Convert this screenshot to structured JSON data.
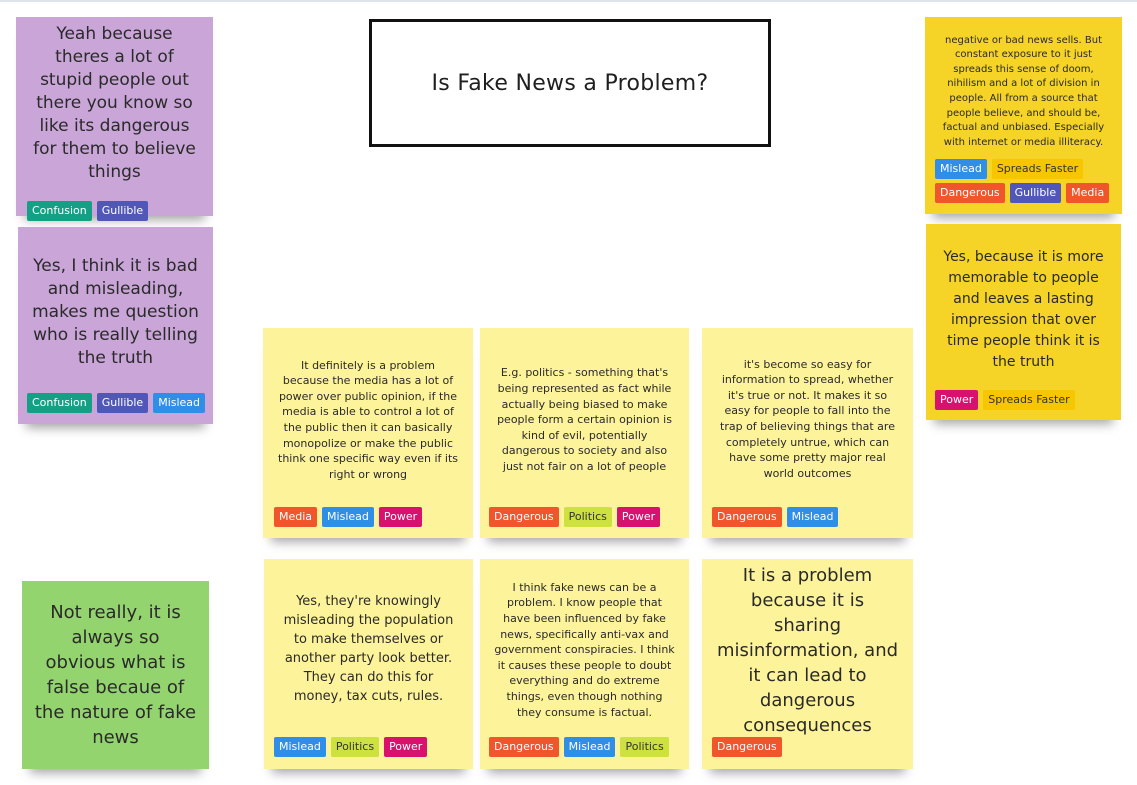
{
  "board": {
    "title": "Is Fake News a Problem?"
  },
  "notes": [
    {
      "text": "Yeah because theres a lot of stupid people out there you know so like its dangerous for them to believe things",
      "tags": [
        "Confusion",
        "Gullible"
      ]
    },
    {
      "text": "Yes, I think it is bad and misleading, makes me question who is really telling the truth",
      "tags": [
        "Confusion",
        "Gullible",
        "Mislead"
      ]
    },
    {
      "text": "Not really, it is always so obvious what is false becaue of the nature of fake news",
      "tags": []
    },
    {
      "text": "It definitely is a problem because the media has a lot of power over public opinion, if the media is able to control a lot of the public then it can basically monopolize or make the public think one specific way even if its right or wrong",
      "tags": [
        "Media",
        "Mislead",
        "Power"
      ]
    },
    {
      "text": "E.g. politics - something that's being represented as fact while actually being biased to make people form a certain opinion is kind of evil, potentially dangerous to society and also just not fair on a lot of people",
      "tags": [
        "Dangerous",
        "Politics",
        "Power"
      ]
    },
    {
      "text": "it's become so easy for information to spread, whether it's true or not. It makes it so easy for people to fall into the trap of believing things that are completely untrue, which can have some pretty major real world outcomes",
      "tags": [
        "Dangerous",
        "Mislead"
      ]
    },
    {
      "text": "Yes, they're knowingly misleading the population to make themselves or another party look better. They can do this for money, tax cuts, rules.",
      "tags": [
        "Mislead",
        "Politics",
        "Power"
      ]
    },
    {
      "text": "I think fake news can be a problem. I know people that have been influenced by fake news, specifically anti-vax and government conspiracies. I think it causes these people to doubt everything and do extreme things, even though nothing they consume is factual.",
      "tags": [
        "Dangerous",
        "Mislead",
        "Politics"
      ]
    },
    {
      "text": "It is a problem because it is sharing misinformation, and it can lead to dangerous consequences",
      "tags": [
        "Dangerous"
      ]
    },
    {
      "text": "negative or bad news sells. But constant exposure to it just spreads this sense of doom, nihilism and a lot of division in people. All from a source that people believe, and should be, factual and unbiased. Especially with internet or media illiteracy.",
      "tags": [
        "Mislead",
        "Spreads Faster",
        "Dangerous",
        "Gullible",
        "Media"
      ]
    },
    {
      "text": "Yes, because it is more memorable to people and leaves a lasting impression that over time people think it is the truth",
      "tags": [
        "Power",
        "Spreads Faster"
      ]
    }
  ],
  "colors": {
    "purple_note": "#c9a5d8",
    "green_note": "#93d46f",
    "yellow_note": "#fdf39a",
    "gold_note": "#f5d327",
    "tag_confusion": "#14a085",
    "tag_gullible": "#5057b8",
    "tag_mislead": "#2f8fe8",
    "tag_media": "#f0552c",
    "tag_power": "#d8116f",
    "tag_dangerous": "#f0552c",
    "tag_politics": "#cde23e",
    "tag_spreads_faster": "#f6c700"
  }
}
